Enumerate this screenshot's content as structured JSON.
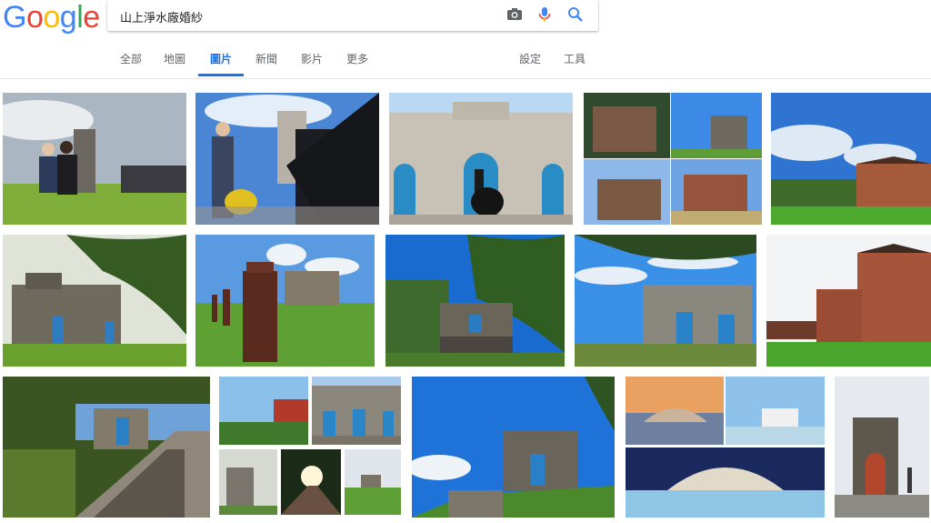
{
  "logo": {
    "letters": [
      "G",
      "o",
      "o",
      "g",
      "l",
      "e"
    ],
    "colors": [
      "#4285f4",
      "#ea4335",
      "#fbbc05",
      "#4285f4",
      "#34a853",
      "#ea4335"
    ]
  },
  "search": {
    "query": "山上淨水廠婚紗"
  },
  "icons": {
    "camera": "camera-icon",
    "mic": "microphone-icon",
    "search": "search-icon"
  },
  "tabs": {
    "all": "全部",
    "maps": "地圖",
    "images": "圖片",
    "news": "新聞",
    "videos": "影片",
    "more": "更多",
    "settings": "設定",
    "tools": "工具"
  },
  "colors": {
    "accent": "#1a73e8"
  }
}
